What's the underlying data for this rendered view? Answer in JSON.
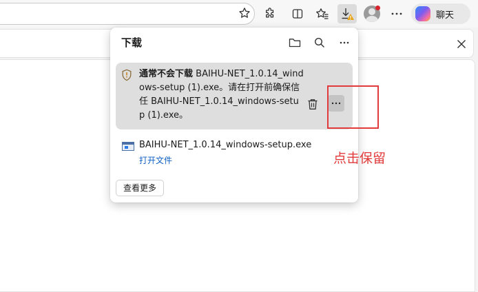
{
  "toolbar": {
    "icons": [
      "star-icon",
      "extensions-icon",
      "split-screen-icon",
      "favorites-icon",
      "downloads-icon",
      "profile-avatar",
      "more-icon",
      "copilot-icon"
    ],
    "chat_label": "聊天",
    "downloads_warning_color": "#e8a317",
    "notification_dot_color": "#d8242f"
  },
  "downloads_panel": {
    "title": "下载",
    "header_icons": [
      "folder-icon",
      "search-icon",
      "more-icon"
    ],
    "warning_item": {
      "message_bold": "通常不会下载",
      "message": " BAIHU-NET_1.0.14_windows-setup (1).exe。请在打开前确保信任 BAIHU-NET_1.0.14_windows-setup (1).exe。",
      "icon": "shield-warning-icon",
      "actions": [
        "trash-icon",
        "more-icon"
      ]
    },
    "file_item": {
      "name": "BAIHU-NET_1.0.14_windows-setup.exe",
      "open_label": "打开文件"
    },
    "see_more_label": "查看更多"
  },
  "annotation": {
    "text": "点击保留",
    "color": "#e23a3a"
  }
}
